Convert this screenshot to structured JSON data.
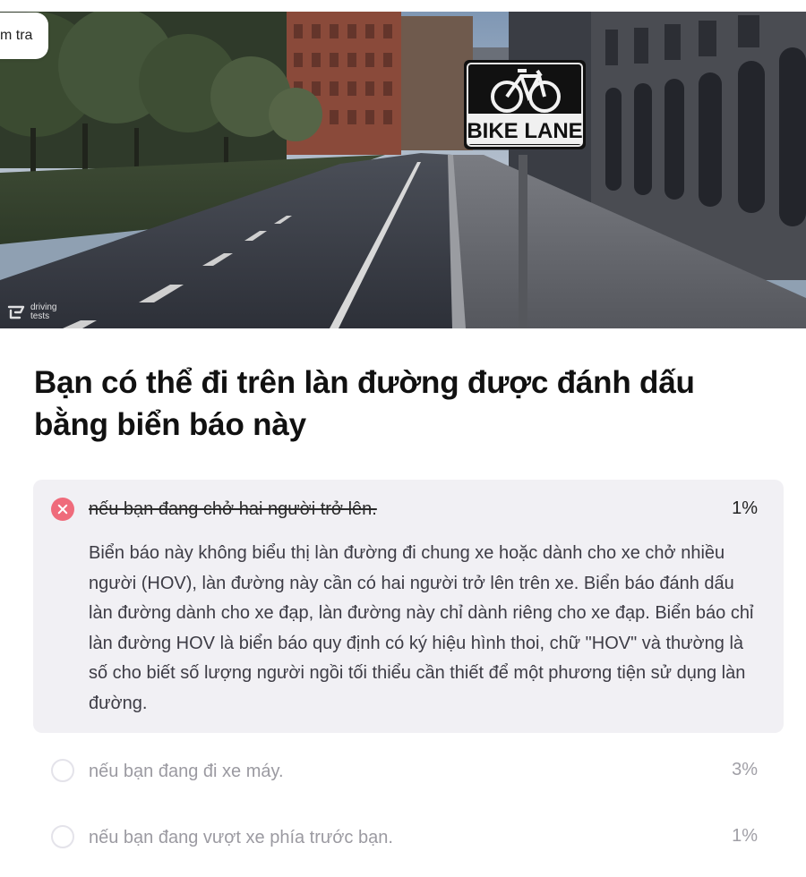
{
  "header": {
    "tab_label": "m tra"
  },
  "image": {
    "sign_text": "BIKE LANE",
    "watermark_line1": "driving",
    "watermark_line2": "tests"
  },
  "question": {
    "text": "Bạn có thể đi trên làn đường được đánh dấu bằng biển báo này"
  },
  "answers": [
    {
      "text": "nếu bạn đang chở hai người trở lên.",
      "percent": "1%",
      "state": "incorrect",
      "explanation": "Biển báo này không biểu thị làn đường đi chung xe hoặc dành cho xe chở nhiều người (HOV), làn đường này cần có hai người trở lên trên xe. Biển báo đánh dấu làn đường dành cho xe đạp, làn đường này chỉ dành riêng cho xe đạp. Biển báo chỉ làn đường HOV là biển báo quy định có ký hiệu hình thoi, chữ \"HOV\" và thường là số cho biết số lượng người ngồi tối thiểu cần thiết để một phương tiện sử dụng làn đường."
    },
    {
      "text": "nếu bạn đang đi xe máy.",
      "percent": "3%",
      "state": "unselected"
    },
    {
      "text": "nếu bạn đang vượt xe phía trước bạn.",
      "percent": "1%",
      "state": "unselected"
    }
  ],
  "colors": {
    "incorrect_icon": "#ef6b7b",
    "card_background": "#f1f0f4",
    "muted_text": "#9b9aa1"
  },
  "icons": {
    "incorrect": "x-circle-icon",
    "unselected": "empty-radio-icon",
    "sign_symbol": "bicycle-icon",
    "watermark": "drivingtests-logo-icon"
  }
}
